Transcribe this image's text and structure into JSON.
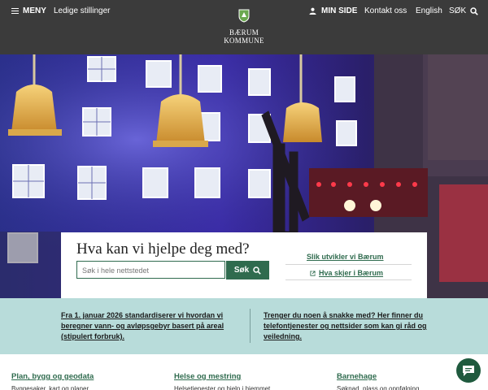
{
  "header": {
    "menu_label": "MENY",
    "vacancies_label": "Ledige stillinger",
    "logo_text_line1": "BÆRUM",
    "logo_text_line2": "KOMMUNE",
    "mypage_label": "MIN SIDE",
    "contact_label": "Kontakt oss",
    "language_label": "English",
    "search_label": "SØK"
  },
  "hero": {
    "image_icon": "hero-photo"
  },
  "search_card": {
    "title": "Hva kan vi hjelpe deg med?",
    "input_placeholder": "Søk i hele nettstedet",
    "button_label": "Søk",
    "links": [
      {
        "label": "Slik utvikler vi Bærum"
      },
      {
        "label": "Hva skjer i Bærum"
      }
    ]
  },
  "info_band": {
    "items": [
      {
        "text": "Fra 1. januar 2026 standardiserer vi hvordan vi beregner vann- og avløpsgebyr basert på areal (stipulert forbruk)."
      },
      {
        "text": "Trenger du noen å snakke med? Her finner du telefontjenester og nettsider som kan gi råd og veiledning."
      }
    ]
  },
  "categories": {
    "items": [
      {
        "label": "Plan, bygg og geodata",
        "desc": "Byggesaker, kart og planer"
      },
      {
        "label": "Helse og mestring",
        "desc": "Helsetjenester og hjelp i hjemmet"
      },
      {
        "label": "Barnehage",
        "desc": "Søknad, plass og oppfølging"
      }
    ]
  },
  "colors": {
    "header_bg": "#3b3b3b",
    "brand_green": "#2f6b4e",
    "info_band_bg": "#b8dcda"
  },
  "chat": {
    "icon": "chat-bubble-icon"
  }
}
